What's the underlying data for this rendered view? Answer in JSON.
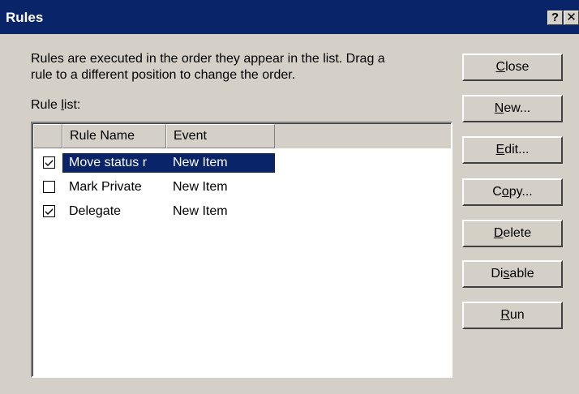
{
  "window": {
    "title": "Rules",
    "help_glyph": "?",
    "close_glyph": "✕"
  },
  "description": "Rules are executed in the order they appear in the list.  Drag a\nrule to a different position to change the order.",
  "rule_list_label": {
    "before": "Rule ",
    "mnemonic": "l",
    "after": "ist:"
  },
  "columns": {
    "check": "",
    "name": "Rule Name",
    "event": "Event"
  },
  "rules": [
    {
      "name": "Move status r",
      "event": "New Item",
      "checked": true,
      "selected": true
    },
    {
      "name": "Mark Private",
      "event": "New Item",
      "checked": false,
      "selected": false
    },
    {
      "name": "Delegate",
      "event": "New Item",
      "checked": true,
      "selected": false
    }
  ],
  "buttons": {
    "close": {
      "mnemonic": "C",
      "rest": "lose"
    },
    "new": {
      "mnemonic": "N",
      "rest": "ew..."
    },
    "edit": {
      "mnemonic": "E",
      "rest": "dit..."
    },
    "copy": {
      "before": "C",
      "mnemonic": "o",
      "rest": "py..."
    },
    "delete": {
      "mnemonic": "D",
      "rest": "elete"
    },
    "disable": {
      "before": "Di",
      "mnemonic": "s",
      "rest": "able"
    },
    "run": {
      "mnemonic": "R",
      "rest": "un"
    }
  },
  "colors": {
    "titlebar": "#0a246a",
    "selection": "#0a246a",
    "face": "#d4d0c8"
  }
}
